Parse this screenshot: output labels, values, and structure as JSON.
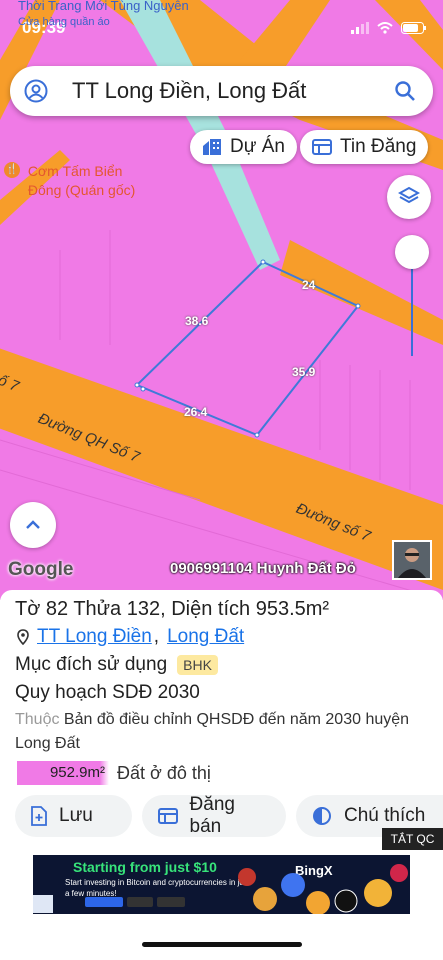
{
  "status_bar": {
    "time": "09:39"
  },
  "poi_top": {
    "name": "Thời Trang Mới Tùng Nguyễn",
    "sub": "Cửa hàng quần áo"
  },
  "search": {
    "query": "TT Long Điền, Long Đất"
  },
  "chips": {
    "projects": "Dự Án",
    "listings": "Tin Đăng"
  },
  "poi_restaurant": {
    "name": "Cơm Tấm Biển Đông (Quán gốc)"
  },
  "parcel_edges": [
    "24",
    "38.6",
    "35.9",
    "26.4"
  ],
  "roads": {
    "qh7": "Đường QH Số 7",
    "so7": "Đường số 7",
    "so7_edge": "ố 7"
  },
  "map_brand": "Google",
  "owner_label": "0906991104 Huynh Đất Đỏ",
  "parcel": {
    "title": "Tờ 82 Thửa 132, Diện tích 953.5m²",
    "town": "TT Long Điền",
    "district": "Long Đất",
    "purpose_label": "Mục đích sử dụng",
    "purpose_code": "BHK",
    "plan": "Quy hoạch SDĐ 2030",
    "belongs_prefix": "Thuộc",
    "belongs_text": "Bản đồ điều chỉnh QHSDĐ đến năm 2030 huyện Long Đất",
    "area_value": "952.9m²",
    "area_type": "Đất ở đô thị"
  },
  "actions": {
    "save": "Lưu",
    "sell": "Đăng bán",
    "legend": "Chú thích"
  },
  "ad": {
    "close": "TẮT QC",
    "headline": "Starting from just $10",
    "sub": "Start investing in Bitcoin and cryptocurrencies in just a few minutes!",
    "brand": "BingX"
  },
  "colors": {
    "land": "#f07ae6",
    "road": "#f79d2a",
    "river": "#a7e2de",
    "parcel": "#3f7ad8",
    "link": "#1a73e8",
    "badge": "#fde9a0"
  }
}
